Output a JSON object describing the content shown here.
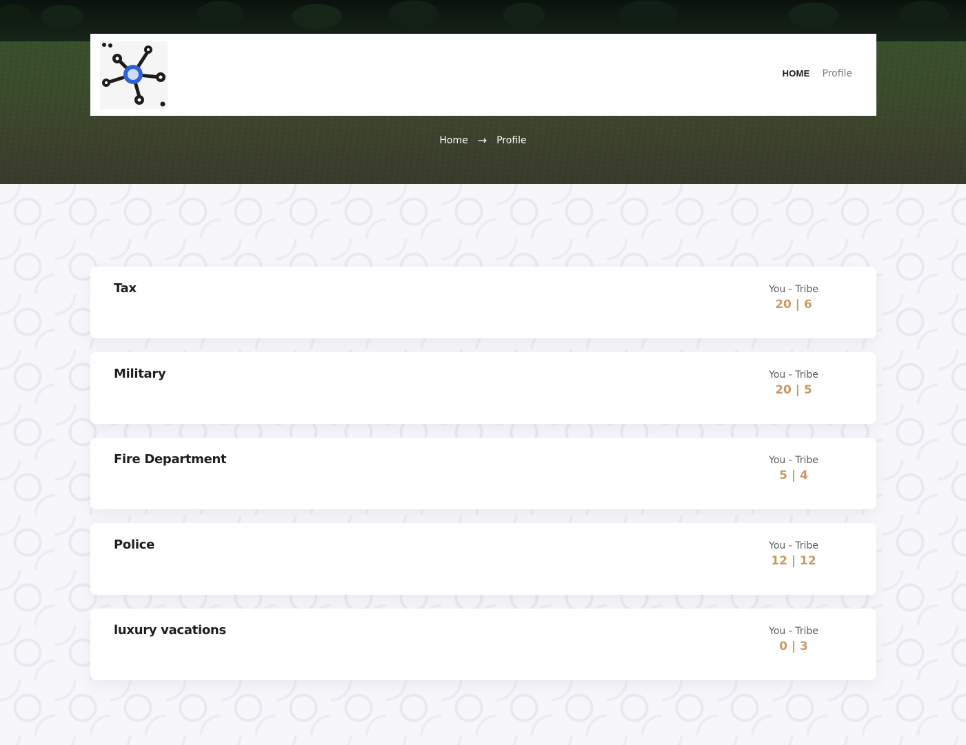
{
  "nav": {
    "home_label": "HOME",
    "profile_label": "Profile"
  },
  "breadcrumb": {
    "home": "Home",
    "separator": "→",
    "current": "Profile"
  },
  "stats_label": "You - Tribe",
  "stats": [
    {
      "title": "Tax",
      "value": "20 | 6"
    },
    {
      "title": "Military",
      "value": "20 | 5"
    },
    {
      "title": "Fire Department",
      "value": "5 | 4"
    },
    {
      "title": "Police",
      "value": "12 | 12"
    },
    {
      "title": "luxury vacations",
      "value": "0 | 3"
    }
  ],
  "colors": {
    "accent": "#c89a64",
    "logo_blue": "#2e63d6"
  }
}
